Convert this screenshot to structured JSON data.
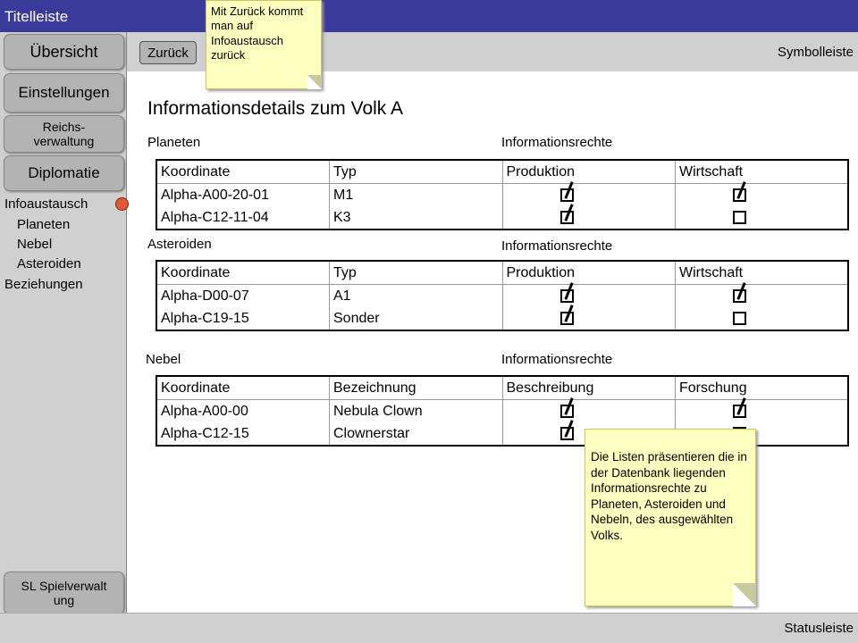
{
  "window": {
    "title": "Titelleiste"
  },
  "sidebar": {
    "buttons": [
      {
        "label": "Übersicht"
      },
      {
        "label": "Einstellungen"
      },
      {
        "label": "Reichs-verwaltung"
      },
      {
        "label": "Diplomatie"
      }
    ],
    "subitems": [
      "Infoaustausch",
      "Planeten",
      "Nebel",
      "Asteroiden",
      "Beziehungen"
    ],
    "bottom_button": {
      "label": "SL Spielverwaltung"
    }
  },
  "toolbar": {
    "back_label": "Zurück",
    "label": "Symbolleiste"
  },
  "status": {
    "label": "Statusleiste"
  },
  "main": {
    "title": "Informationsdetails zum Volk A",
    "planeten": {
      "label": "Planeten",
      "rights_label": "Informationsrechte",
      "headers": [
        "Koordinate",
        "Typ",
        "Produktion",
        "Wirtschaft"
      ],
      "rows": [
        {
          "c1": "Alpha-A00-20-01",
          "c2": "M1",
          "r1": true,
          "r2": true
        },
        {
          "c1": "Alpha-C12-11-04",
          "c2": "K3",
          "r1": true,
          "r2": false
        }
      ]
    },
    "asteroiden": {
      "label": "Asteroiden",
      "rights_label": "Informationsrechte",
      "headers": [
        "Koordinate",
        "Typ",
        "Produktion",
        "Wirtschaft"
      ],
      "rows": [
        {
          "c1": "Alpha-D00-07",
          "c2": "A1",
          "r1": true,
          "r2": true
        },
        {
          "c1": "Alpha-C19-15",
          "c2": "Sonder",
          "r1": true,
          "r2": false
        }
      ]
    },
    "nebel": {
      "label": "Nebel",
      "rights_label": "Informationsrechte",
      "headers": [
        "Koordinate",
        "Bezeichnung",
        "Beschreibung",
        "Forschung"
      ],
      "rows": [
        {
          "c1": "Alpha-A00-00",
          "c2": "Nebula Clown",
          "r1": true,
          "r2": true
        },
        {
          "c1": "Alpha-C12-15",
          "c2": "Clownerstar",
          "r1": true,
          "r2": false
        }
      ]
    }
  },
  "notes": {
    "back_note": "Mit Zurück kommt man auf Infoaustausch zurück",
    "list_note": "Die Listen präsentieren die in der Datenbank liegenden Informationsrechte zu Planeten, Asteroiden und Nebeln, des ausgewählten Volks."
  }
}
